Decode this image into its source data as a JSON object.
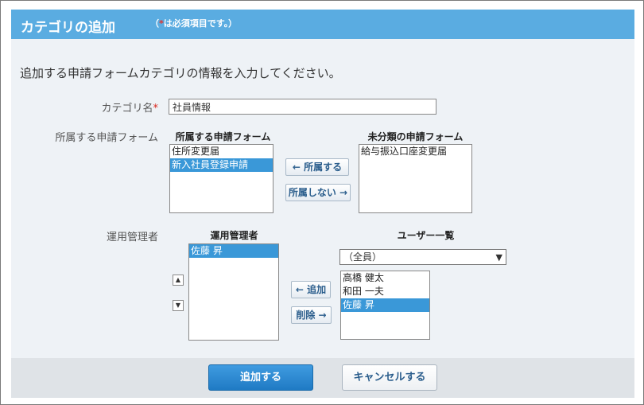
{
  "header": {
    "title": "カテゴリの追加",
    "required_note_prefix": "（",
    "required_star": "*",
    "required_note_suffix": "は必須項目です。）"
  },
  "intro": "追加する申請フォームカテゴリの情報を入力してください。",
  "category": {
    "label": "カテゴリ名",
    "required_mark": "*",
    "value": "社員情報"
  },
  "forms": {
    "label": "所属する申請フォーム",
    "assigned_heading": "所属する申請フォーム",
    "assigned_items": [
      {
        "label": "住所変更届",
        "selected": false
      },
      {
        "label": "新入社員登録申請",
        "selected": true
      }
    ],
    "add_button": "← 所属する",
    "remove_button": "所属しない →",
    "unassigned_heading": "未分類の申請フォーム",
    "unassigned_items": [
      {
        "label": "給与振込口座変更届",
        "selected": false
      }
    ]
  },
  "admins": {
    "label": "運用管理者",
    "assigned_heading": "運用管理者",
    "assigned_items": [
      {
        "label": "佐藤 昇",
        "selected": true
      }
    ],
    "up_icon": "triangle-up-icon",
    "down_icon": "triangle-down-icon",
    "add_button": "← 追加",
    "remove_button": "削除 →",
    "users_heading": "ユーザー一覧",
    "group_select": "（全員）",
    "user_items": [
      {
        "label": "高橋 健太",
        "selected": false
      },
      {
        "label": "和田 一夫",
        "selected": false
      },
      {
        "label": "佐藤 昇",
        "selected": true
      }
    ]
  },
  "footer": {
    "submit": "追加する",
    "cancel": "キャンセルする"
  },
  "colors": {
    "header_bg": "#5aace1",
    "panel_bg": "#eef2f6",
    "selected_bg": "#3a98d8",
    "required": "#d9261c"
  }
}
